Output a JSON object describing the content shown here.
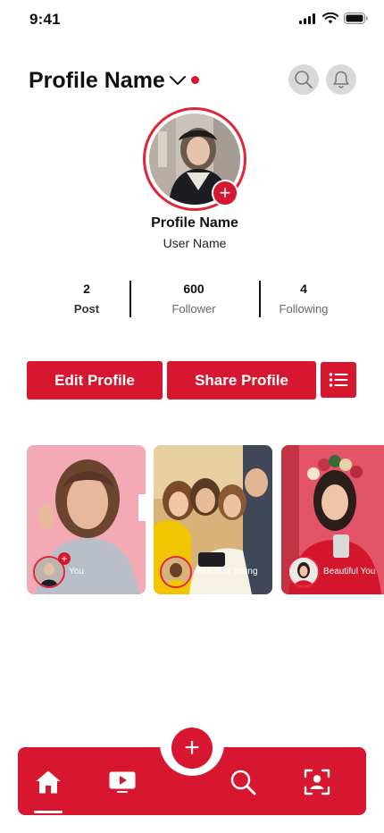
{
  "status_bar": {
    "time": "9:41"
  },
  "header": {
    "title": "Profile Name"
  },
  "profile": {
    "name": "Profile Name",
    "username": "User Name"
  },
  "stats": [
    {
      "value": "2",
      "label": "Post"
    },
    {
      "value": "600",
      "label": "Follower"
    },
    {
      "value": "4",
      "label": "Following"
    }
  ],
  "actions": {
    "edit_label": "Edit Profile",
    "share_label": "Share Profile"
  },
  "stories": [
    {
      "label": "You"
    },
    {
      "label": "Beautiful Young"
    },
    {
      "label": "Beautiful You"
    }
  ],
  "icons": {
    "add": "+"
  },
  "colors": {
    "accent": "#d7172f",
    "icon_bg": "#d9d9d9",
    "nav_bg": "#d7172f"
  }
}
